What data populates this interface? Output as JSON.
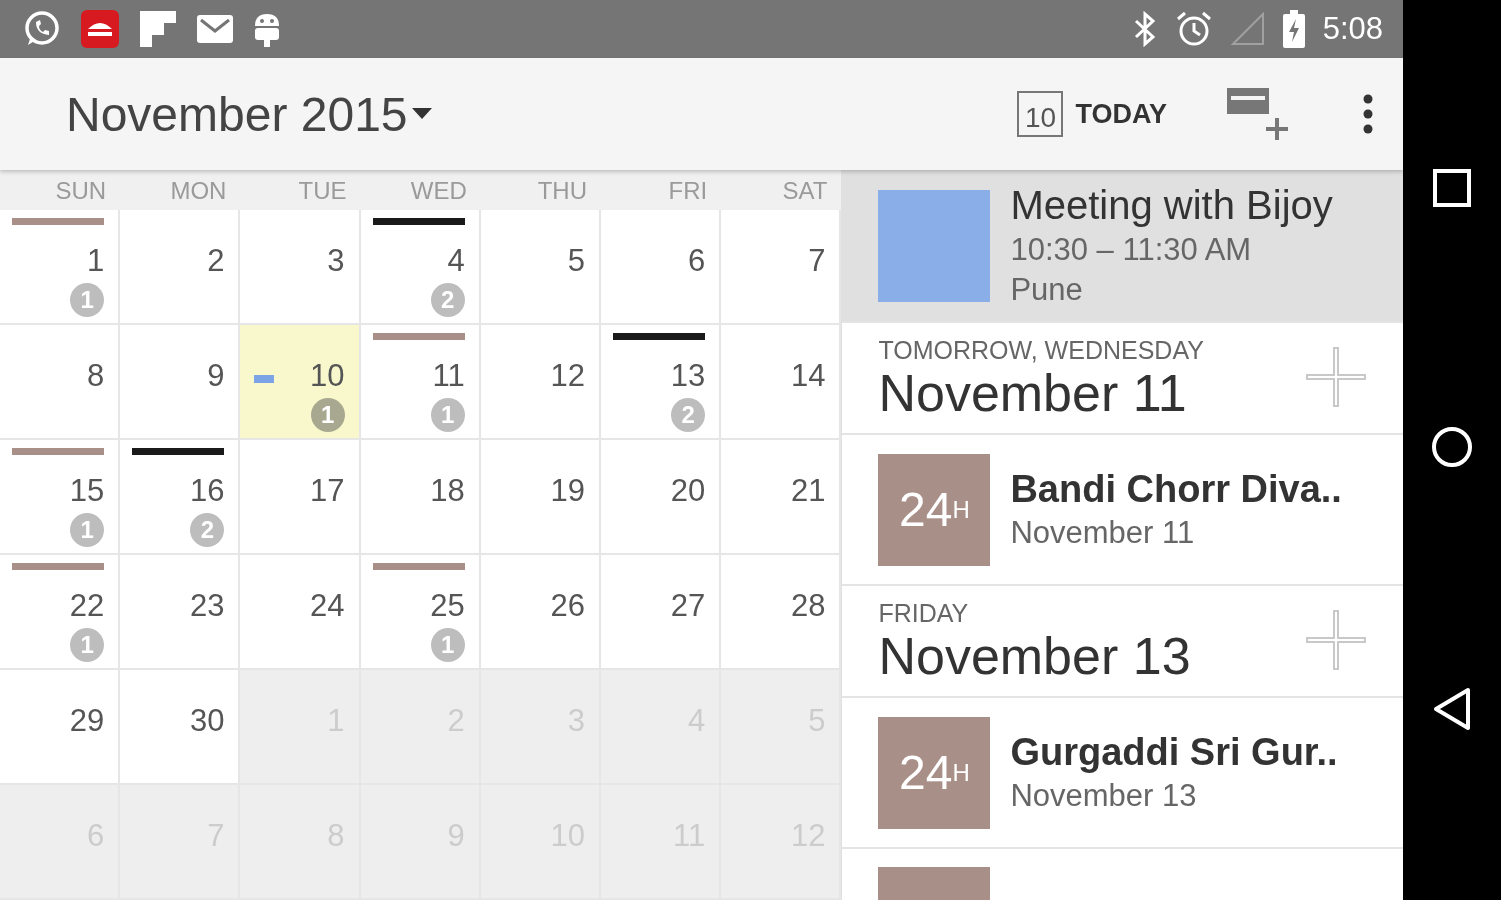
{
  "status_bar": {
    "time": "5:08"
  },
  "toolbar": {
    "title": "November 2015",
    "today_number": "10",
    "today_label": "TODAY"
  },
  "calendar": {
    "weekdays": [
      "SUN",
      "MON",
      "TUE",
      "WED",
      "THU",
      "FRI",
      "SAT"
    ],
    "weeks": [
      [
        {
          "kind": "bar",
          "day": "1",
          "outside": false,
          "today": false,
          "color": "#a89089",
          "count": "1"
        },
        {
          "kind": "plain",
          "day": "2",
          "outside": false,
          "today": false
        },
        {
          "kind": "plain",
          "day": "3",
          "outside": false,
          "today": false
        },
        {
          "kind": "bar",
          "day": "4",
          "outside": false,
          "today": false,
          "color": "#1a1a1a",
          "count": "2"
        },
        {
          "kind": "plain",
          "day": "5",
          "outside": false,
          "today": false
        },
        {
          "kind": "plain",
          "day": "6",
          "outside": false,
          "today": false
        },
        {
          "kind": "plain",
          "day": "7",
          "outside": false,
          "today": false
        }
      ],
      [
        {
          "kind": "plain",
          "day": "8",
          "outside": false,
          "today": false
        },
        {
          "kind": "plain",
          "day": "9",
          "outside": false,
          "today": false
        },
        {
          "kind": "dot",
          "day": "10",
          "outside": false,
          "today": true,
          "color": "#7ba3e6",
          "count": "1"
        },
        {
          "kind": "bar",
          "day": "11",
          "outside": false,
          "today": false,
          "color": "#a89089",
          "count": "1"
        },
        {
          "kind": "plain",
          "day": "12",
          "outside": false,
          "today": false
        },
        {
          "kind": "bar",
          "day": "13",
          "outside": false,
          "today": false,
          "color": "#1a1a1a",
          "count": "2"
        },
        {
          "kind": "plain",
          "day": "14",
          "outside": false,
          "today": false
        }
      ],
      [
        {
          "kind": "bar",
          "day": "15",
          "outside": false,
          "today": false,
          "color": "#a89089",
          "count": "1"
        },
        {
          "kind": "bar",
          "day": "16",
          "outside": false,
          "today": false,
          "color": "#1a1a1a",
          "count": "2"
        },
        {
          "kind": "plain",
          "day": "17",
          "outside": false,
          "today": false
        },
        {
          "kind": "plain",
          "day": "18",
          "outside": false,
          "today": false
        },
        {
          "kind": "plain",
          "day": "19",
          "outside": false,
          "today": false
        },
        {
          "kind": "plain",
          "day": "20",
          "outside": false,
          "today": false
        },
        {
          "kind": "plain",
          "day": "21",
          "outside": false,
          "today": false
        }
      ],
      [
        {
          "kind": "bar",
          "day": "22",
          "outside": false,
          "today": false,
          "color": "#a89089",
          "count": "1"
        },
        {
          "kind": "plain",
          "day": "23",
          "outside": false,
          "today": false
        },
        {
          "kind": "plain",
          "day": "24",
          "outside": false,
          "today": false
        },
        {
          "kind": "bar",
          "day": "25",
          "outside": false,
          "today": false,
          "color": "#a89089",
          "count": "1"
        },
        {
          "kind": "plain",
          "day": "26",
          "outside": false,
          "today": false
        },
        {
          "kind": "plain",
          "day": "27",
          "outside": false,
          "today": false
        },
        {
          "kind": "plain",
          "day": "28",
          "outside": false,
          "today": false
        }
      ],
      [
        {
          "kind": "plain",
          "day": "29",
          "outside": false,
          "today": false
        },
        {
          "kind": "plain",
          "day": "30",
          "outside": false,
          "today": false
        },
        {
          "kind": "plain",
          "day": "1",
          "outside": true,
          "today": false
        },
        {
          "kind": "plain",
          "day": "2",
          "outside": true,
          "today": false
        },
        {
          "kind": "plain",
          "day": "3",
          "outside": true,
          "today": false
        },
        {
          "kind": "plain",
          "day": "4",
          "outside": true,
          "today": false
        },
        {
          "kind": "plain",
          "day": "5",
          "outside": true,
          "today": false
        }
      ],
      [
        {
          "kind": "plain",
          "day": "6",
          "outside": true,
          "today": false
        },
        {
          "kind": "plain",
          "day": "7",
          "outside": true,
          "today": false
        },
        {
          "kind": "plain",
          "day": "8",
          "outside": true,
          "today": false
        },
        {
          "kind": "plain",
          "day": "9",
          "outside": true,
          "today": false
        },
        {
          "kind": "plain",
          "day": "10",
          "outside": true,
          "today": false
        },
        {
          "kind": "plain",
          "day": "11",
          "outside": true,
          "today": false
        },
        {
          "kind": "plain",
          "day": "12",
          "outside": true,
          "today": false
        }
      ]
    ]
  },
  "agenda": [
    {
      "kind": "event",
      "selected": true,
      "color": "#8aaee8",
      "title": "Meeting with Bijoy",
      "time": "10:30 – 11:30 AM",
      "location": "Pune"
    },
    {
      "kind": "header",
      "label": "TOMORROW, WEDNESDAY",
      "date": "November 11"
    },
    {
      "kind": "allday",
      "selected": false,
      "color": "#a89089",
      "tile": "24$^{H}$",
      "title": "Bandi Chorr Diva..",
      "date": "November 11"
    },
    {
      "kind": "header",
      "label": "FRIDAY",
      "date": "November 13"
    },
    {
      "kind": "allday",
      "selected": false,
      "color": "#a89089",
      "tile": "24$^{H}$",
      "title": "Gurgaddi Sri Gur..",
      "date": "November 13"
    },
    {
      "kind": "partial",
      "color": "#a89089"
    }
  ]
}
